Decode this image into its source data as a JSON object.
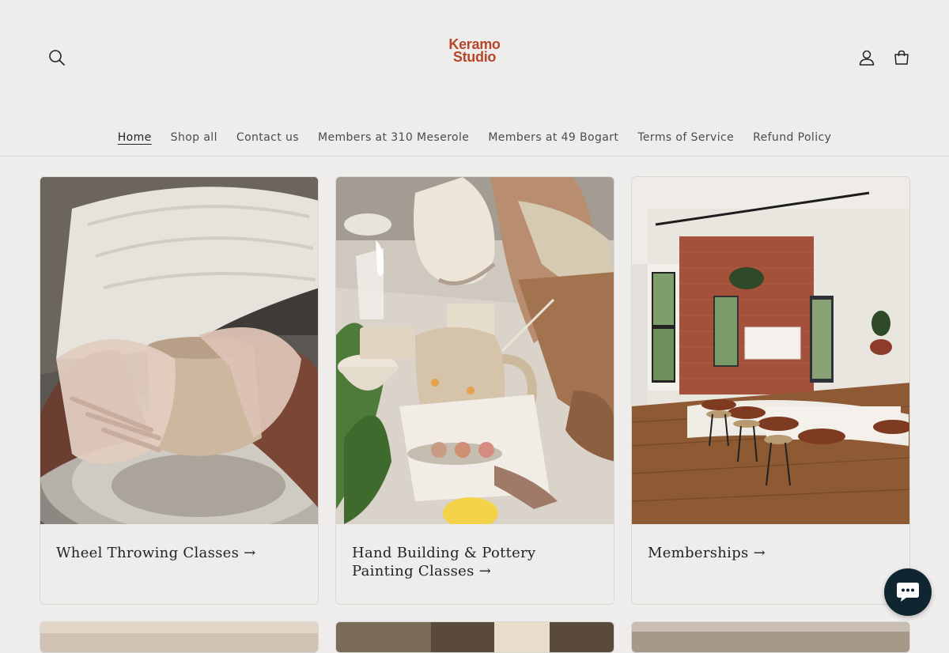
{
  "brand": {
    "line1": "Keramo",
    "line2": "Studio",
    "color": "#b5462a"
  },
  "header": {
    "icons": {
      "search": "search-icon",
      "account": "user-icon",
      "cart": "cart-icon"
    },
    "nav": [
      {
        "label": "Home",
        "active": true
      },
      {
        "label": "Shop all"
      },
      {
        "label": "Contact us"
      },
      {
        "label": "Members at 310 Meserole"
      },
      {
        "label": "Members at 49 Bogart"
      },
      {
        "label": "Terms of Service"
      },
      {
        "label": "Refund Policy"
      }
    ]
  },
  "collections": [
    {
      "label": "Wheel Throwing Classes →"
    },
    {
      "label": "Hand Building & Pottery Painting Classes →"
    },
    {
      "label": "Memberships →"
    }
  ],
  "chat": {
    "icon": "chat-bubble-icon",
    "color": "#0f2530"
  }
}
